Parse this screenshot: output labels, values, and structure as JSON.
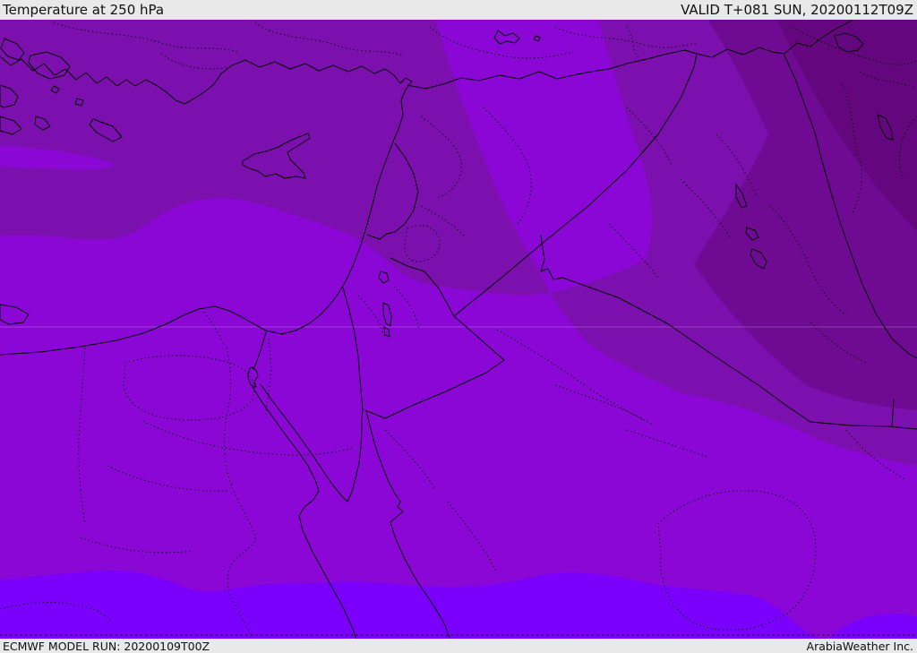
{
  "header": {
    "title": "Temperature at 250 hPa",
    "valid": "VALID T+081 SUN, 20200112T09Z"
  },
  "footer": {
    "model_run": "ECMWF MODEL RUN: 20200109T00Z",
    "company": "ArabiaWeather Inc."
  },
  "map": {
    "parameter": "Temperature",
    "level": "250 hPa",
    "model": "ECMWF",
    "colors": {
      "band_coldest": "#64077E",
      "band_cold": "#6F0A93",
      "band_mid": "#7C10AE",
      "band_main": "#8A07D6",
      "band_warm": "#7B00FB",
      "header_bg": "#E9E9E9",
      "line": "#000000"
    }
  }
}
